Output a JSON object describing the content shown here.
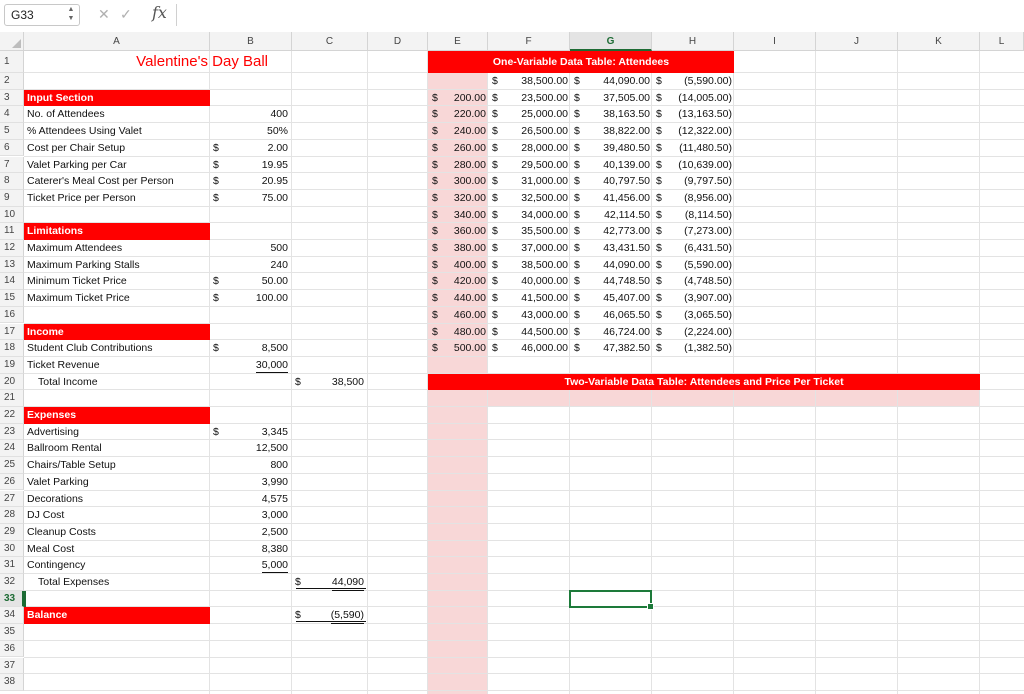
{
  "formula_bar": {
    "name_box": "G33",
    "formula": ""
  },
  "columns": [
    "A",
    "B",
    "C",
    "D",
    "E",
    "F",
    "G",
    "H",
    "I",
    "J",
    "K",
    "L"
  ],
  "active_column": "G",
  "rows": [
    "1",
    "2",
    "3",
    "4",
    "5",
    "6",
    "7",
    "8",
    "9",
    "10",
    "11",
    "12",
    "13",
    "14",
    "15",
    "16",
    "17",
    "18",
    "19",
    "20",
    "21",
    "22",
    "23",
    "24",
    "25",
    "26",
    "27",
    "28",
    "29",
    "30",
    "31",
    "32",
    "33",
    "34",
    "35",
    "36",
    "37",
    "38"
  ],
  "active_row": "33",
  "title": "Valentine's Day Ball",
  "input_section": {
    "header": "Input Section",
    "items": [
      {
        "label": "No. of Attendees",
        "dollar": "",
        "value": "400"
      },
      {
        "label": "% Attendees Using Valet",
        "dollar": "",
        "value": "50%"
      },
      {
        "label": "Cost per Chair Setup",
        "dollar": "$",
        "value": "2.00"
      },
      {
        "label": "Valet Parking per Car",
        "dollar": "$",
        "value": "19.95"
      },
      {
        "label": "Caterer's Meal Cost per Person",
        "dollar": "$",
        "value": "20.95"
      },
      {
        "label": "Ticket Price per Person",
        "dollar": "$",
        "value": "75.00"
      }
    ]
  },
  "limitations": {
    "header": "Limitations",
    "items": [
      {
        "label": "Maximum Attendees",
        "dollar": "",
        "value": "500"
      },
      {
        "label": "Maximum Parking Stalls",
        "dollar": "",
        "value": "240"
      },
      {
        "label": "Minimum Ticket Price",
        "dollar": "$",
        "value": "50.00"
      },
      {
        "label": "Maximum Ticket Price",
        "dollar": "$",
        "value": "100.00"
      }
    ]
  },
  "income": {
    "header": "Income",
    "items": [
      {
        "label": "Student Club Contributions",
        "dollar": "$",
        "value": "8,500"
      },
      {
        "label": "Ticket Revenue",
        "dollar": "",
        "value": "30,000"
      }
    ],
    "total_label": "Total Income",
    "total_dollar": "$",
    "total_value": "38,500"
  },
  "expenses": {
    "header": "Expenses",
    "items": [
      {
        "label": "Advertising",
        "dollar": "$",
        "value": "3,345"
      },
      {
        "label": "Ballroom Rental",
        "dollar": "",
        "value": "12,500"
      },
      {
        "label": "Chairs/Table Setup",
        "dollar": "",
        "value": "800"
      },
      {
        "label": "Valet Parking",
        "dollar": "",
        "value": "3,990"
      },
      {
        "label": "Decorations",
        "dollar": "",
        "value": "4,575"
      },
      {
        "label": "DJ Cost",
        "dollar": "",
        "value": "3,000"
      },
      {
        "label": "Cleanup Costs",
        "dollar": "",
        "value": "2,500"
      },
      {
        "label": "Meal Cost",
        "dollar": "",
        "value": "8,380"
      },
      {
        "label": "Contingency",
        "dollar": "",
        "value": "5,000"
      }
    ],
    "total_label": "Total Expenses",
    "total_dollar": "$",
    "total_value": "44,090"
  },
  "balance": {
    "label": "Balance",
    "dollar": "$",
    "value": "(5,590)"
  },
  "one_var_table": {
    "title": "One-Variable Data Table: Attendees",
    "header_row": [
      "",
      "38,500.00",
      "44,090.00",
      "(5,590.00)"
    ],
    "rows": [
      [
        "200.00",
        "23,500.00",
        "37,505.00",
        "(14,005.00)"
      ],
      [
        "220.00",
        "25,000.00",
        "38,163.50",
        "(13,163.50)"
      ],
      [
        "240.00",
        "26,500.00",
        "38,822.00",
        "(12,322.00)"
      ],
      [
        "260.00",
        "28,000.00",
        "39,480.50",
        "(11,480.50)"
      ],
      [
        "280.00",
        "29,500.00",
        "40,139.00",
        "(10,639.00)"
      ],
      [
        "300.00",
        "31,000.00",
        "40,797.50",
        "(9,797.50)"
      ],
      [
        "320.00",
        "32,500.00",
        "41,456.00",
        "(8,956.00)"
      ],
      [
        "340.00",
        "34,000.00",
        "42,114.50",
        "(8,114.50)"
      ],
      [
        "360.00",
        "35,500.00",
        "42,773.00",
        "(7,273.00)"
      ],
      [
        "380.00",
        "37,000.00",
        "43,431.50",
        "(6,431.50)"
      ],
      [
        "400.00",
        "38,500.00",
        "44,090.00",
        "(5,590.00)"
      ],
      [
        "420.00",
        "40,000.00",
        "44,748.50",
        "(4,748.50)"
      ],
      [
        "440.00",
        "41,500.00",
        "45,407.00",
        "(3,907.00)"
      ],
      [
        "460.00",
        "43,000.00",
        "46,065.50",
        "(3,065.50)"
      ],
      [
        "480.00",
        "44,500.00",
        "46,724.00",
        "(2,224.00)"
      ],
      [
        "500.00",
        "46,000.00",
        "47,382.50",
        "(1,382.50)"
      ]
    ]
  },
  "two_var_table": {
    "title": "Two-Variable Data Table: Attendees and Price Per Ticket"
  },
  "currency_symbol": "$",
  "colors": {
    "accent_red": "#ff0000",
    "pink_fill": "#f8d7d7",
    "selection_green": "#1d7a3a"
  },
  "icons": {
    "cancel": "close-icon",
    "confirm": "check-icon",
    "function": "fx-icon"
  }
}
